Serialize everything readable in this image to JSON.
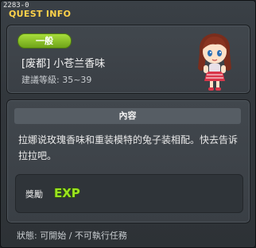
{
  "window": {
    "quest_id": "2283-0",
    "title": "QUEST INFO"
  },
  "quest": {
    "category_badge": "一般",
    "name": "[废都] 小苍兰香味",
    "level": "建議等級: 35~39"
  },
  "content": {
    "header": "內容",
    "description": "拉娜说玫瑰香味和重装模特的兔子装相配。快去告诉拉拉吧。"
  },
  "reward": {
    "label": "獎勵",
    "icon": "exp-icon",
    "icon_text": "EXP"
  },
  "status": {
    "text": "狀態:  可開始 / 不可執行任務"
  },
  "colors": {
    "title": "#ffd24a",
    "badge": "#8cc22a",
    "exp": "#9be31f"
  }
}
